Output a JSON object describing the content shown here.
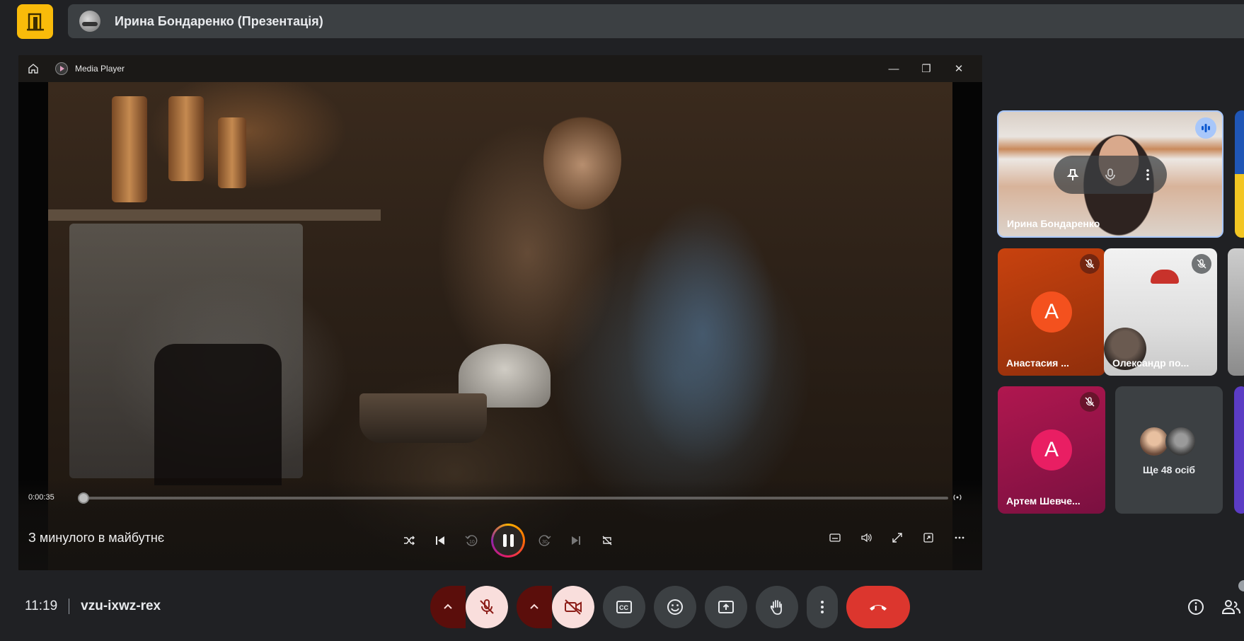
{
  "header": {
    "presenter_title": "Ирина Бондаренко (Презентація)"
  },
  "media_player": {
    "app_title": "Media Player",
    "current_time": "0:00:35",
    "progress_fraction": 0.0,
    "media_title": "З минулого в майбутнє",
    "skip_back_label": "10",
    "skip_forward_label": "30",
    "window_buttons": {
      "minimize": "—",
      "restore": "❐",
      "close": "✕"
    }
  },
  "participants": [
    {
      "name": "Ирина Бондаренко",
      "state": "speaking"
    },
    {
      "name": "Анастасия ...",
      "initial": "A",
      "avatar_color": "#f4511e",
      "muted": true
    },
    {
      "name": "Олександр по...",
      "muted": true
    },
    {
      "name": "Артем Шевче...",
      "initial": "A",
      "avatar_color": "#e91e63",
      "muted": true
    }
  ],
  "more_participants": {
    "label": "Ще 48 осіб"
  },
  "meeting": {
    "time": "11:19",
    "code": "vzu-ixwz-rex"
  },
  "colors": {
    "accent_blue": "#a8c7fa",
    "hangup_red": "#dc362e",
    "toggle_off_bg": "#f9dedc",
    "logo_yellow": "#f9bb0a"
  },
  "icons": {
    "logo": "door-exit-icon",
    "mic": "mic-off-icon",
    "camera": "camera-off-icon",
    "captions": "closed-captions-icon",
    "reactions": "emoji-icon",
    "present": "present-screen-icon",
    "hand": "raise-hand-icon",
    "more": "more-vert-icon",
    "hangup": "call-end-icon",
    "info": "info-icon",
    "people": "people-icon"
  }
}
